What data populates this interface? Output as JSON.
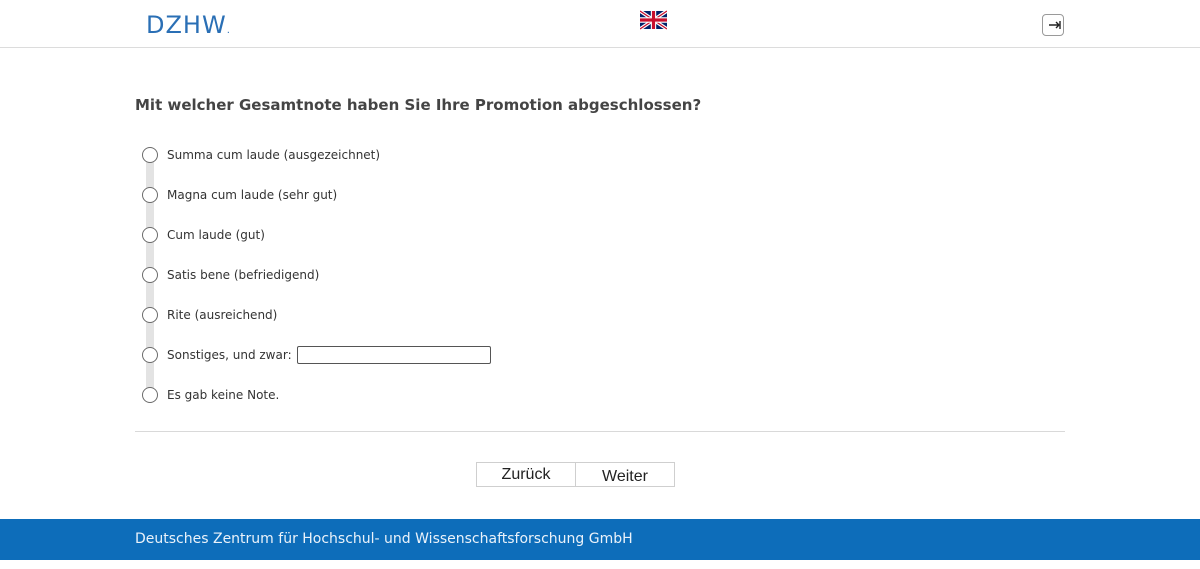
{
  "header": {
    "logo_text": "DZHW",
    "logo_dot": ".",
    "language_icon": "uk-flag-icon",
    "logout_icon": "logout-icon"
  },
  "survey": {
    "question": "Mit welcher Gesamtnote haben Sie Ihre Promotion abgeschlossen?",
    "options": [
      {
        "label": "Summa cum laude (ausgezeichnet)"
      },
      {
        "label": "Magna cum laude (sehr gut)"
      },
      {
        "label": "Cum laude (gut)"
      },
      {
        "label": "Satis bene (befriedigend)"
      },
      {
        "label": "Rite (ausreichend)"
      },
      {
        "label": "Sonstiges, und zwar:",
        "input_value": ""
      },
      {
        "label": "Es gab keine Note."
      }
    ]
  },
  "navigation": {
    "back_label": "Zurück",
    "next_label": "Weiter"
  },
  "footer": {
    "text": "Deutsches Zentrum für Hochschul- und Wissenschaftsforschung GmbH"
  },
  "colors": {
    "brand_blue": "#0d6dba",
    "logo_blue": "#2a6fb5"
  }
}
